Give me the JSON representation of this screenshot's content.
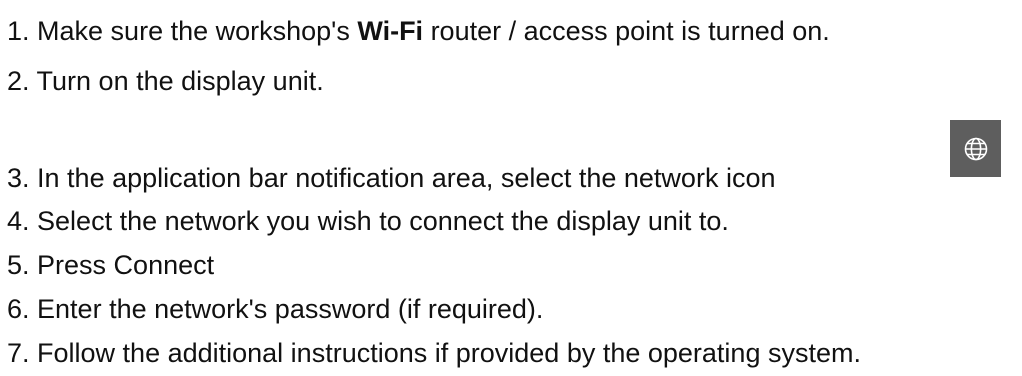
{
  "steps": [
    {
      "number": "1.",
      "before": " Make sure the workshop's ",
      "bold": "Wi-Fi",
      "after": " router / access point is turned on."
    },
    {
      "number": "2.",
      "text": " Turn on the display unit."
    },
    {
      "number": "3.",
      "text": " In the application bar notification area, select the network icon"
    },
    {
      "number": "4.",
      "text": " Select the network you wish to connect the display unit to."
    },
    {
      "number": "5.",
      "text": " Press Connect"
    },
    {
      "number": "6.",
      "text": " Enter the network's password (if required)."
    },
    {
      "number": "7.",
      "text": " Follow the additional instructions if provided by the operating system."
    }
  ],
  "network_icon": {
    "icon": "globe-icon",
    "background": "#5e5e5e",
    "stroke": "#ffffff"
  }
}
